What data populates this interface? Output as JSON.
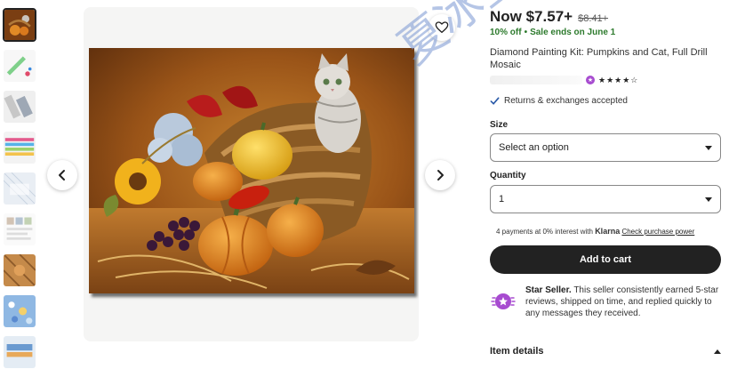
{
  "product": {
    "price_now": "Now $7.57+",
    "price_old": "$8.41+",
    "discount": "10% off",
    "sale_ends": "Sale ends on June 1",
    "title": "Diamond Painting Kit: Pumpkins and Cat, Full Drill Mosaic",
    "rating_stars": "★★★★☆",
    "returns": "Returns & exchanges accepted"
  },
  "size": {
    "label": "Size",
    "selected": "Select an option"
  },
  "quantity": {
    "label": "Quantity",
    "selected": "1"
  },
  "klarna": {
    "prefix": "4 payments at 0% interest with",
    "brand": "Klarna",
    "link": "Check purchase power"
  },
  "cart": {
    "label": "Add to cart"
  },
  "seller": {
    "badge": "Star Seller.",
    "text": "This seller consistently earned 5-star reviews, shipped on time, and replied quickly to any messages they received."
  },
  "item_details": {
    "label": "Item details"
  },
  "watermark": "夏冰星球",
  "colors": {
    "accent_green": "#2d7a2d",
    "cart_bg": "#222222",
    "star_seller": "#a74bd0",
    "watermark": "#7896d2"
  },
  "icons": [
    "heart-icon",
    "chevron-left-icon",
    "chevron-right-icon",
    "check-icon",
    "star-seller-icon",
    "caret-down-icon",
    "chevron-up-icon"
  ]
}
